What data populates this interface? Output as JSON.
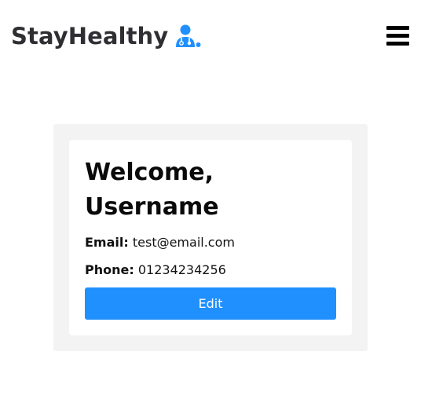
{
  "navbar": {
    "brand_text": "StayHealthy",
    "brand_icon": "doctor-icon",
    "menu_icon": "hamburger-menu-icon"
  },
  "profile": {
    "welcome_line1": "Welcome,",
    "welcome_line2": "Username",
    "email_label": "Email:",
    "email_value": "test@email.com",
    "phone_label": "Phone:",
    "phone_value": "01234234256",
    "edit_label": "Edit"
  },
  "colors": {
    "accent": "#2190ff",
    "panel_background": "#f3f3f3",
    "brand_text": "#2f2f33"
  }
}
